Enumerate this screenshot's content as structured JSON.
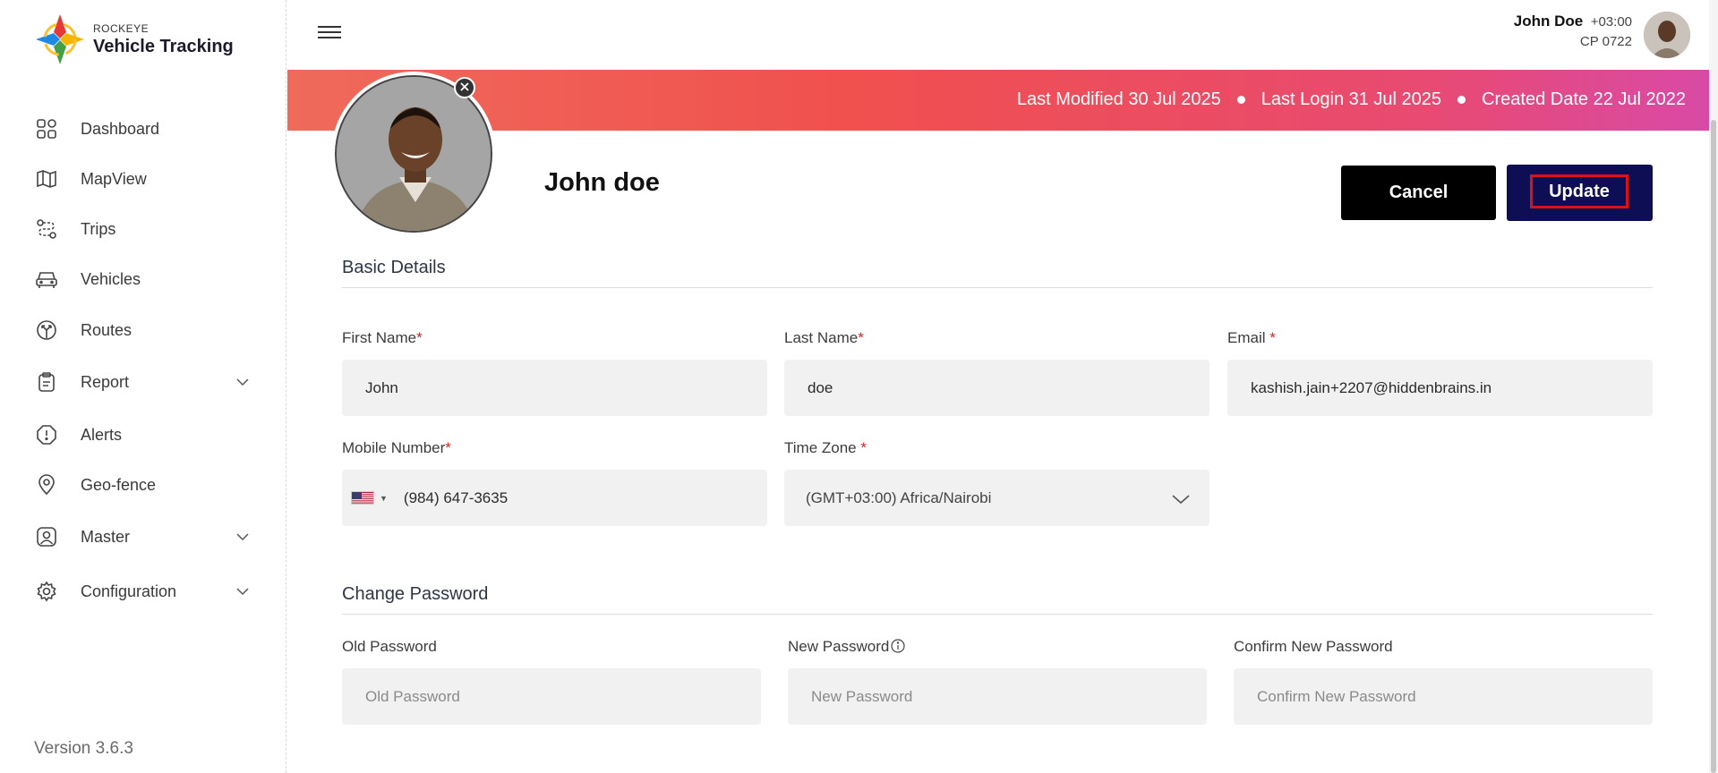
{
  "app": {
    "brand_small": "ROCKEYE",
    "brand_name": "Vehicle Tracking",
    "version": "Version 3.6.3"
  },
  "sidebar": {
    "items": [
      {
        "label": "Dashboard",
        "icon": "grid-icon"
      },
      {
        "label": "MapView",
        "icon": "map-icon"
      },
      {
        "label": "Trips",
        "icon": "route-icon"
      },
      {
        "label": "Vehicles",
        "icon": "car-icon"
      },
      {
        "label": "Routes",
        "icon": "signpost-icon"
      },
      {
        "label": "Report",
        "icon": "clipboard-icon",
        "expandable": true
      },
      {
        "label": "Alerts",
        "icon": "alert-icon"
      },
      {
        "label": "Geo-fence",
        "icon": "location-pin-icon"
      },
      {
        "label": "Master",
        "icon": "user-square-icon",
        "expandable": true
      },
      {
        "label": "Configuration",
        "icon": "gear-icon",
        "expandable": true
      }
    ]
  },
  "header": {
    "user_name": "John Doe",
    "timezone": "+03:00",
    "user_code": "CP 0722"
  },
  "banner": {
    "last_modified": "Last Modified 30 Jul 2025",
    "last_login": "Last Login 31 Jul 2025",
    "created_date": "Created Date 22 Jul 2022"
  },
  "profile": {
    "name": "John doe",
    "cancel_label": "Cancel",
    "update_label": "Update"
  },
  "basic_details": {
    "title": "Basic Details",
    "first_name_label": "First Name",
    "first_name_value": "John",
    "last_name_label": "Last Name",
    "last_name_value": "doe",
    "email_label": "Email ",
    "email_value": "kashish.jain+2207@hiddenbrains.in",
    "mobile_label": "Mobile Number",
    "mobile_value": "(984) 647-3635",
    "timezone_label": "Time Zone ",
    "timezone_value": "(GMT+03:00) Africa/Nairobi",
    "required_mark": "*"
  },
  "change_password": {
    "title": "Change Password",
    "old_label": "Old Password",
    "old_placeholder": "Old Password",
    "new_label": "New Password",
    "new_placeholder": "New Password",
    "confirm_label": "Confirm New Password",
    "confirm_placeholder": "Confirm New Password"
  },
  "colors": {
    "update_button": "#0e0e55",
    "cancel_button": "#000000",
    "highlight_border": "#e0101a",
    "banner_start": "#ef6a5a",
    "banner_end": "#d84aa6"
  }
}
